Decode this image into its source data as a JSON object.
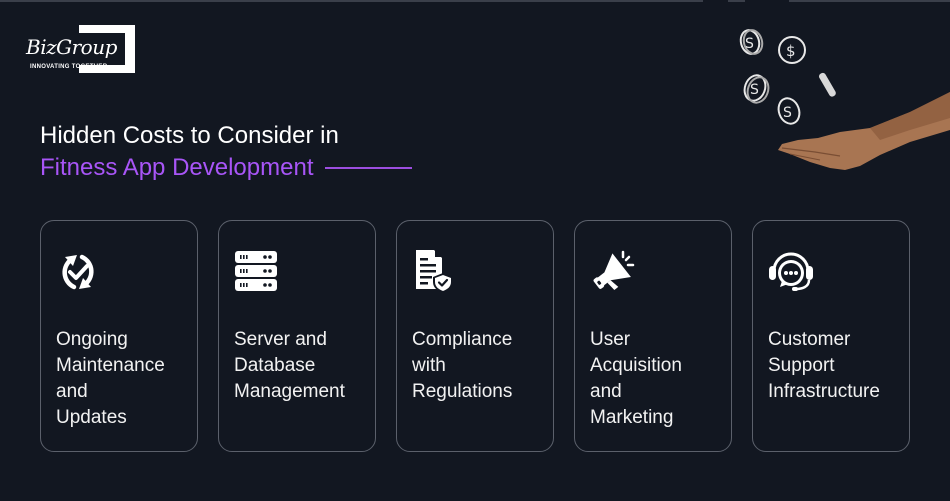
{
  "logo": {
    "wordmark": "BizGroup",
    "tagline": "INNOVATING TOGETHER"
  },
  "heading": {
    "line1": "Hidden Costs to Consider in",
    "line2": "Fitness App Development"
  },
  "colors": {
    "background": "#121721",
    "accent": "#a855f7",
    "text": "#ffffff",
    "card_border": "#5b606b"
  },
  "hero": {
    "icon": "hand-catching-dollar-coins-icon"
  },
  "cards": [
    {
      "icon": "refresh-check-icon",
      "label": "Ongoing\nMaintenance\nand\nUpdates"
    },
    {
      "icon": "server-icon",
      "label": "Server and\nDatabase\nManagement"
    },
    {
      "icon": "document-shield-icon",
      "label": "Compliance\nwith\nRegulations"
    },
    {
      "icon": "megaphone-icon",
      "label": "User\nAcquisition\nand\nMarketing"
    },
    {
      "icon": "headset-chat-icon",
      "label": "Customer\nSupport\nInfrastructure"
    }
  ]
}
